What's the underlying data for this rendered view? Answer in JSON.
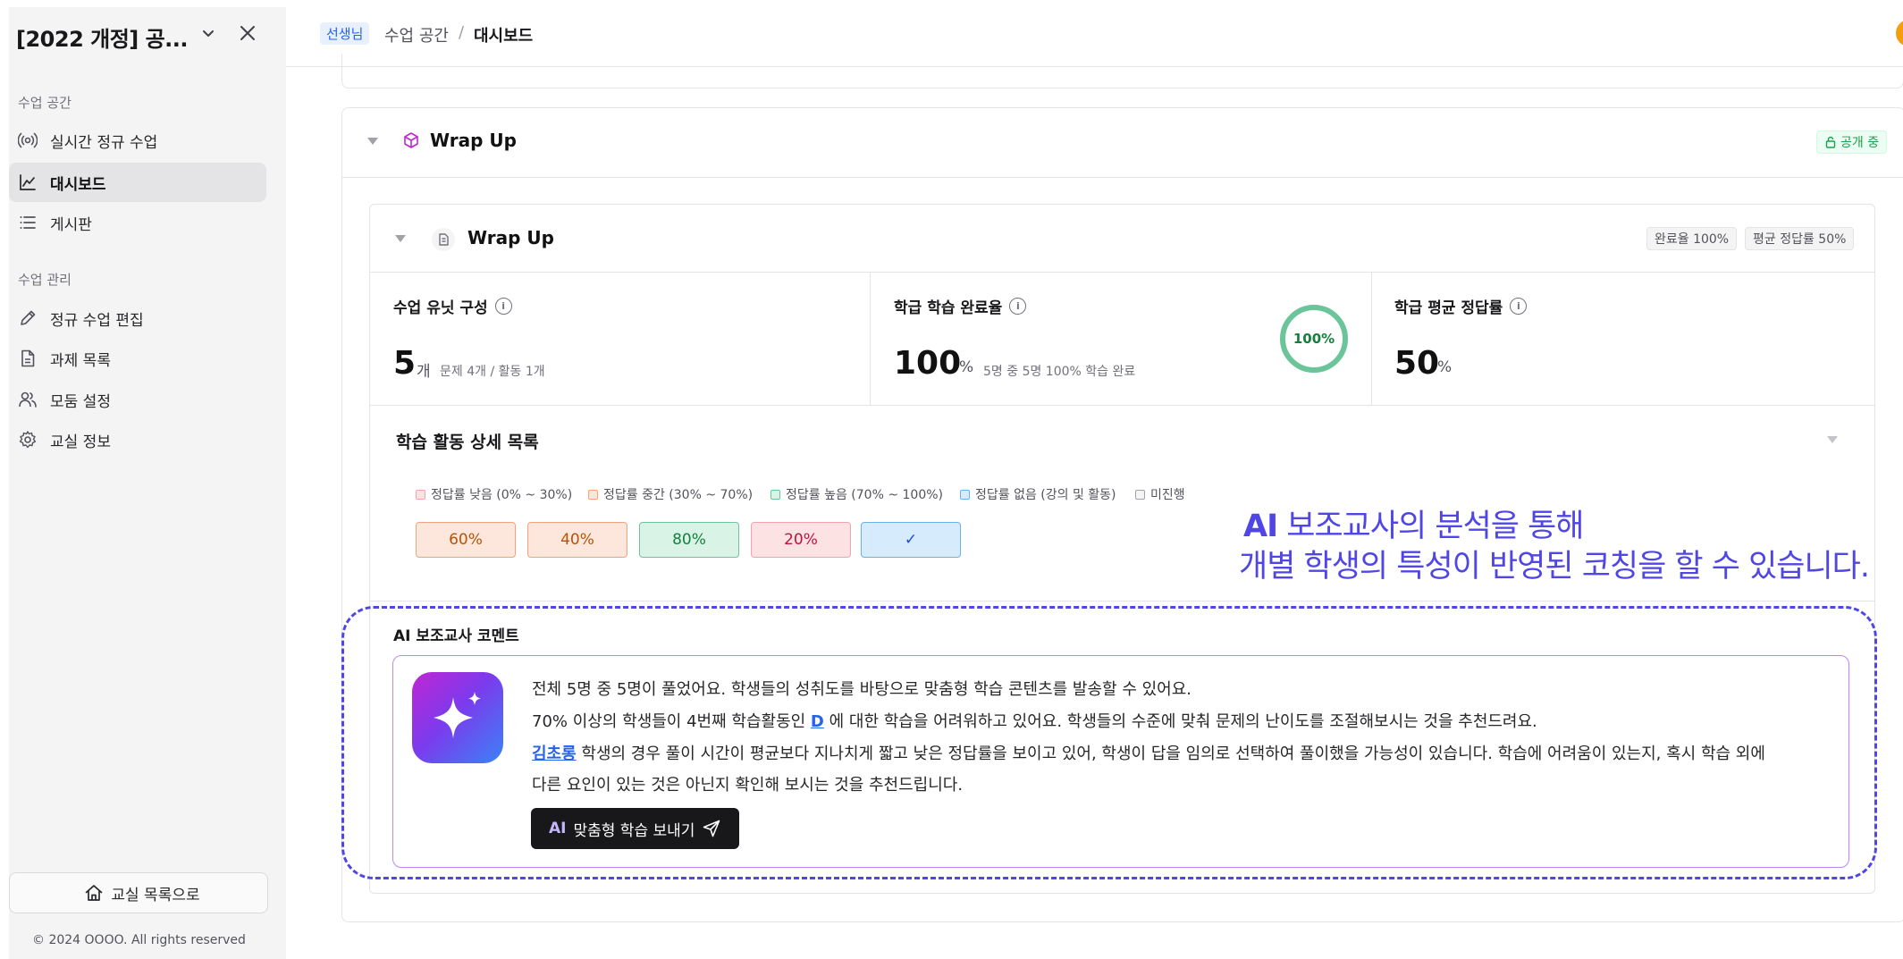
{
  "sidebar": {
    "classroom_title": "[2022 개정] 공...",
    "sections": [
      {
        "heading": "수업 공간",
        "items": [
          {
            "label": "실시간 정규 수업",
            "icon": "broadcast-icon",
            "active": false
          },
          {
            "label": "대시보드",
            "icon": "chart-icon",
            "active": true
          },
          {
            "label": "게시판",
            "icon": "list-icon",
            "active": false
          }
        ]
      },
      {
        "heading": "수업 관리",
        "items": [
          {
            "label": "정규 수업 편집",
            "icon": "pencil-icon",
            "active": false
          },
          {
            "label": "과제 목록",
            "icon": "document-icon",
            "active": false
          },
          {
            "label": "모둠 설정",
            "icon": "group-icon",
            "active": false
          },
          {
            "label": "교실 정보",
            "icon": "gear-icon",
            "active": false
          }
        ]
      }
    ],
    "home_button": "교실 목록으로",
    "copyright": "© 2024 OOOO. All rights reserved"
  },
  "header": {
    "role_badge": "선생님",
    "breadcrumb": [
      "수업 공간",
      "대시보드"
    ],
    "separator": "/"
  },
  "section": {
    "title": "Wrap Up",
    "status_badge": "공개 중"
  },
  "unit": {
    "title": "Wrap Up",
    "completion_pill": "완료율 100%",
    "average_pill": "평균 정답률 50%",
    "stats": [
      {
        "title": "수업 유닛 구성",
        "value": "5",
        "unit": "개",
        "sub": "문제 4개 / 활동 1개"
      },
      {
        "title": "학급 학습 완료율",
        "value": "100",
        "unit": "%",
        "sub": "5명 중 5명 100% 학습 완료",
        "ring_label": "100%",
        "ring_progress": 1.0
      },
      {
        "title": "학급 평균 정답률",
        "value": "50",
        "unit": "%"
      }
    ]
  },
  "detail": {
    "title": "학습 활동 상세 목록",
    "legend": [
      {
        "label": "정답률 낮음 (0% ~ 30%)",
        "color": "#f4a3ab"
      },
      {
        "label": "정답률 중간 (30% ~ 70%)",
        "color": "#f4a37b"
      },
      {
        "label": "정답률 높음 (70% ~ 100%)",
        "color": "#6cc49a"
      },
      {
        "label": "정답률 없음 (강의 및 활동)",
        "color": "#67b2e8"
      },
      {
        "label": "미진행",
        "color": "#a1a1aa"
      }
    ],
    "tiles": [
      "60%",
      "40%",
      "80%",
      "20%",
      "✓"
    ]
  },
  "overlay": {
    "line1_prefix": "AI",
    "line1_rest": " 보조교사의 분석을 통해",
    "line2": "개별 학생의 특성이 반영된 코칭을 할 수 있습니다."
  },
  "ai_comment": {
    "label": "AI 보조교사 코멘트",
    "line1": "전체 5명 중 5명이 풀었어요. 학생들의 성취도를 바탕으로 맞춤형 학습 콘텐츠를 발송할 수 있어요.",
    "line2_pre": "70% 이상의 학생들이 4번째 학습활동인 ",
    "line2_link": "D",
    "line2_post": " 에 대한 학습을 어려워하고 있어요. 학생들의 수준에 맞춰 문제의 난이도를 조절해보시는 것을 추천드려요.",
    "line3_link": "김초롱",
    "line3_post": " 학생의 경우 풀이 시간이 평균보다 지나치게 짧고 낮은 정답률을 보이고 있어, 학생이 답을 임의로 선택하여 풀이했을 가능성이 있습니다. 학습에 어려움이 있는지, 혹시 학습 외에",
    "line4": "다른 요인이 있는 것은 아닌지 확인해 보시는 것을 추천드립니다.",
    "send_tag": "AI",
    "send_label": "맞춤형 학습 보내기"
  },
  "colors": {
    "accent": "#4f46e5",
    "ai_gradient": [
      "#c026d3",
      "#7c3aed",
      "#3b82f6"
    ],
    "public_badge": "#16a34a",
    "ring": "#16a34a"
  }
}
